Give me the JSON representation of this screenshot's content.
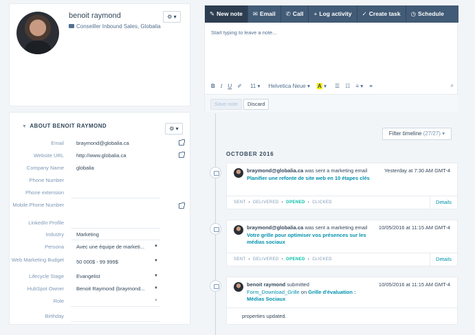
{
  "profile": {
    "name": "benoit raymond",
    "title": "Conseiller Inbound Sales, Globalia",
    "settings_label": "⚙ ▾"
  },
  "about": {
    "title": "ABOUT BENOIT RAYMOND",
    "settings_label": "⚙ ▾",
    "properties": [
      {
        "label": "Email",
        "value": "braymond@globalia.ca"
      },
      {
        "label": "Website URL",
        "value": "http://www.globalia.ca"
      },
      {
        "label": "Company Name",
        "value": "globalia"
      },
      {
        "label": "Phone Number",
        "value": ""
      },
      {
        "label": "Phone extension",
        "value": ""
      },
      {
        "label": "Mobile Phone Number",
        "value": ""
      },
      {
        "label": "LinkedIn Profile",
        "value": ""
      },
      {
        "label": "Industry",
        "value": "Marketing"
      },
      {
        "label": "Persona",
        "value": "Avec une équipe de marketi..."
      },
      {
        "label": "Web Marketing Budget",
        "value": "50 000$ - 99 999$"
      },
      {
        "label": "Lifecycle Stage",
        "value": "Evangelist"
      },
      {
        "label": "HubSpot Owner",
        "value": "Benoit Raymond (braymond..."
      },
      {
        "label": "Role",
        "value": ""
      },
      {
        "label": "Birthday",
        "value": ""
      }
    ]
  },
  "composer": {
    "tabs": [
      {
        "icon": "✎",
        "label": "New note"
      },
      {
        "icon": "✉",
        "label": "Email"
      },
      {
        "icon": "✆",
        "label": "Call"
      },
      {
        "icon": "+",
        "label": "Log activity"
      },
      {
        "icon": "✓",
        "label": "Create task"
      },
      {
        "icon": "◷",
        "label": "Schedule"
      }
    ],
    "placeholder": "Start typing to leave a note...",
    "toolbar": {
      "bold": "B",
      "italic": "I",
      "underline": "U",
      "strike": "✐",
      "font_size": "11 ▾",
      "font_family": "Helvetica Neue ▾",
      "highlight": "A",
      "highlight_caret": "▾",
      "bullets": "☰",
      "numbered": "☷",
      "align": "≡",
      "align_caret": "▾",
      "link": "⚭",
      "attach": "⌕"
    },
    "save_label": "Save note",
    "discard_label": "Discard"
  },
  "timeline": {
    "filter_label": "Filter timeline",
    "filter_count": "(27/27) ▾",
    "month": "OCTOBER 2016",
    "events": [
      {
        "actor": "braymond@globalia.ca",
        "action": "was sent a marketing email",
        "link": "Planifier une refonte de site web en 10 étapes clés",
        "time": "Yesterday at 7:30 AM GMT-4",
        "steps": [
          "SENT",
          "DELIVERED",
          "OPENED",
          "CLICKED"
        ],
        "details": "Details"
      },
      {
        "actor": "braymond@globalia.ca",
        "action": "was sent a marketing email",
        "link": "Votre grille pour optimiser vos présences sur les médias sociaux",
        "time": "10/05/2016 at 11:15 AM GMT-4",
        "steps": [
          "SENT",
          "DELIVERED",
          "OPENED",
          "CLICKED"
        ],
        "details": "Details"
      },
      {
        "actor": "benoit raymond",
        "action": "submitted",
        "form": "Form_Download_Grille",
        "on": "on",
        "link": "Grille d'évaluation : Médias Sociaux",
        "time": "10/05/2016 at 11:15 AM GMT-4",
        "body": "properties updated."
      }
    ]
  }
}
